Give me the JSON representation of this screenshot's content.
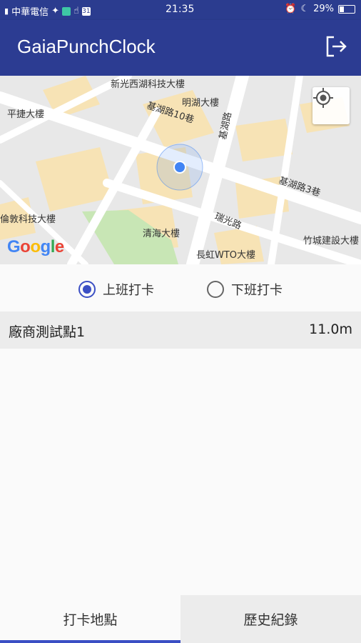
{
  "status_bar": {
    "carrier": "中華電信",
    "time": "21:35",
    "battery": "29%",
    "calendar_day": "31"
  },
  "app_bar": {
    "title": "GaiaPunchClock",
    "logout_icon": "logout-icon"
  },
  "map": {
    "labels": [
      "新光西湖科技大樓",
      "明湖大樓",
      "平捷大樓",
      "基湖路10巷",
      "基湖路",
      "基湖路3巷",
      "瑞光路",
      "清海大樓",
      "倫敦科技大樓",
      "竹城建設大樓",
      "長虹WTO大樓"
    ],
    "google_logo": "Google",
    "locate_icon": "my-location-icon"
  },
  "punch_type": {
    "options": [
      {
        "label": "上班打卡",
        "checked": true
      },
      {
        "label": "下班打卡",
        "checked": false
      }
    ]
  },
  "locations": [
    {
      "name": "廠商測試點1",
      "distance": "11.0m"
    }
  ],
  "tabs": [
    {
      "label": "打卡地點",
      "active": true
    },
    {
      "label": "歷史紀錄",
      "active": false
    }
  ],
  "colors": {
    "primary": "#2c3c92",
    "accent": "#3b4fc4",
    "location_dot": "#4285f4"
  }
}
